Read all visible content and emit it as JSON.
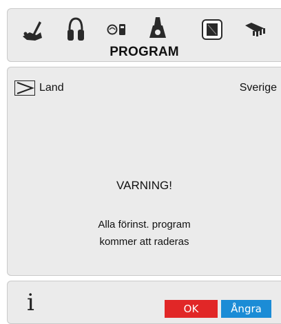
{
  "header": {
    "title": "PROGRAM",
    "icons": [
      "tools-icon",
      "headphones-icon",
      "remote-icon",
      "parental-lock-icon",
      "book-icon",
      "scart-connector-icon"
    ]
  },
  "setting": {
    "icon": "play-arrow-icon",
    "label": "Land",
    "value": "Sverige"
  },
  "warning": {
    "title": "VARNING!",
    "line1": "Alla förinst. program",
    "line2": "kommer att raderas"
  },
  "footer": {
    "info_glyph": "i",
    "ok_label": "OK",
    "cancel_label": "Ångra",
    "ok_color": "#e12727",
    "cancel_color": "#1b8cd6"
  }
}
